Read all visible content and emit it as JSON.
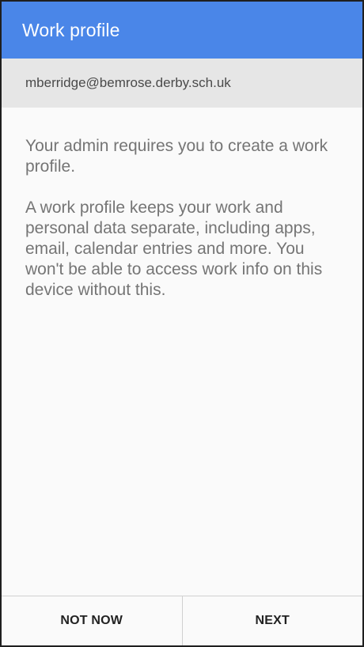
{
  "app_bar": {
    "title": "Work profile",
    "color": "#4a86e8"
  },
  "account": {
    "email": "mberridge@bemrose.derby.sch.uk"
  },
  "content": {
    "paragraph_1": "Your admin requires you to create a work profile.",
    "paragraph_2": "A work profile keeps your work and personal data separate, including apps, email, calendar entries and more. You won't be able to access work info on this device without this."
  },
  "bottom_bar": {
    "not_now_label": "NOT NOW",
    "next_label": "NEXT"
  }
}
